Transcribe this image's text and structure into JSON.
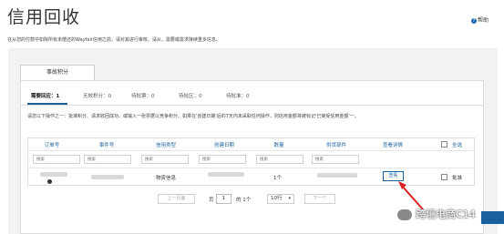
{
  "page": {
    "title": "信用回收",
    "help_label": "帮助",
    "description": "在从您的付款中扣除所有未偿还的Wayfair信用之前，请对其进行审核。请从，需要或需求接续重多信息。"
  },
  "main_tab": {
    "label": "事故积分"
  },
  "status_tabs": [
    {
      "label": "需要回应：1",
      "active": true
    },
    {
      "label": "无效积分：0",
      "active": false
    },
    {
      "label": "待批票：0",
      "active": false
    },
    {
      "label": "待批区：0",
      "active": false
    },
    {
      "label": "待批准：0",
      "active": false
    }
  ],
  "instructions": "请您以下操作之一：批准积分、请求收回成功、或输入一张票据以竞争积分。如果在'创建日期'后的7天内未采取任何操作，则信用金额将被标记'已接受信用金额'一。",
  "table": {
    "headers": {
      "order_no": "订单号",
      "incident_no": "事件号",
      "credit_type": "信用类型",
      "created_date": "创建日期",
      "quantity": "数量",
      "supplier_part": "供货部件",
      "check_details": "查看详情",
      "select_all": "全选"
    },
    "filter_placeholder": "搜索",
    "row": {
      "credit_type": "物资信息",
      "quantity": "1个",
      "view_label": "查看",
      "approve_label": "批准"
    }
  },
  "pagination": {
    "prev_label": "上一页面",
    "page_prefix": "页",
    "current_page": "1",
    "of_label": "的 1个",
    "page_size": "10行",
    "next_label": "下一个"
  },
  "watermark": "跨境电商C14",
  "colors": {
    "accent": "#1a5f9e",
    "annotation_arrow": "#e02020",
    "panel_bg": "#f2f2f2"
  }
}
